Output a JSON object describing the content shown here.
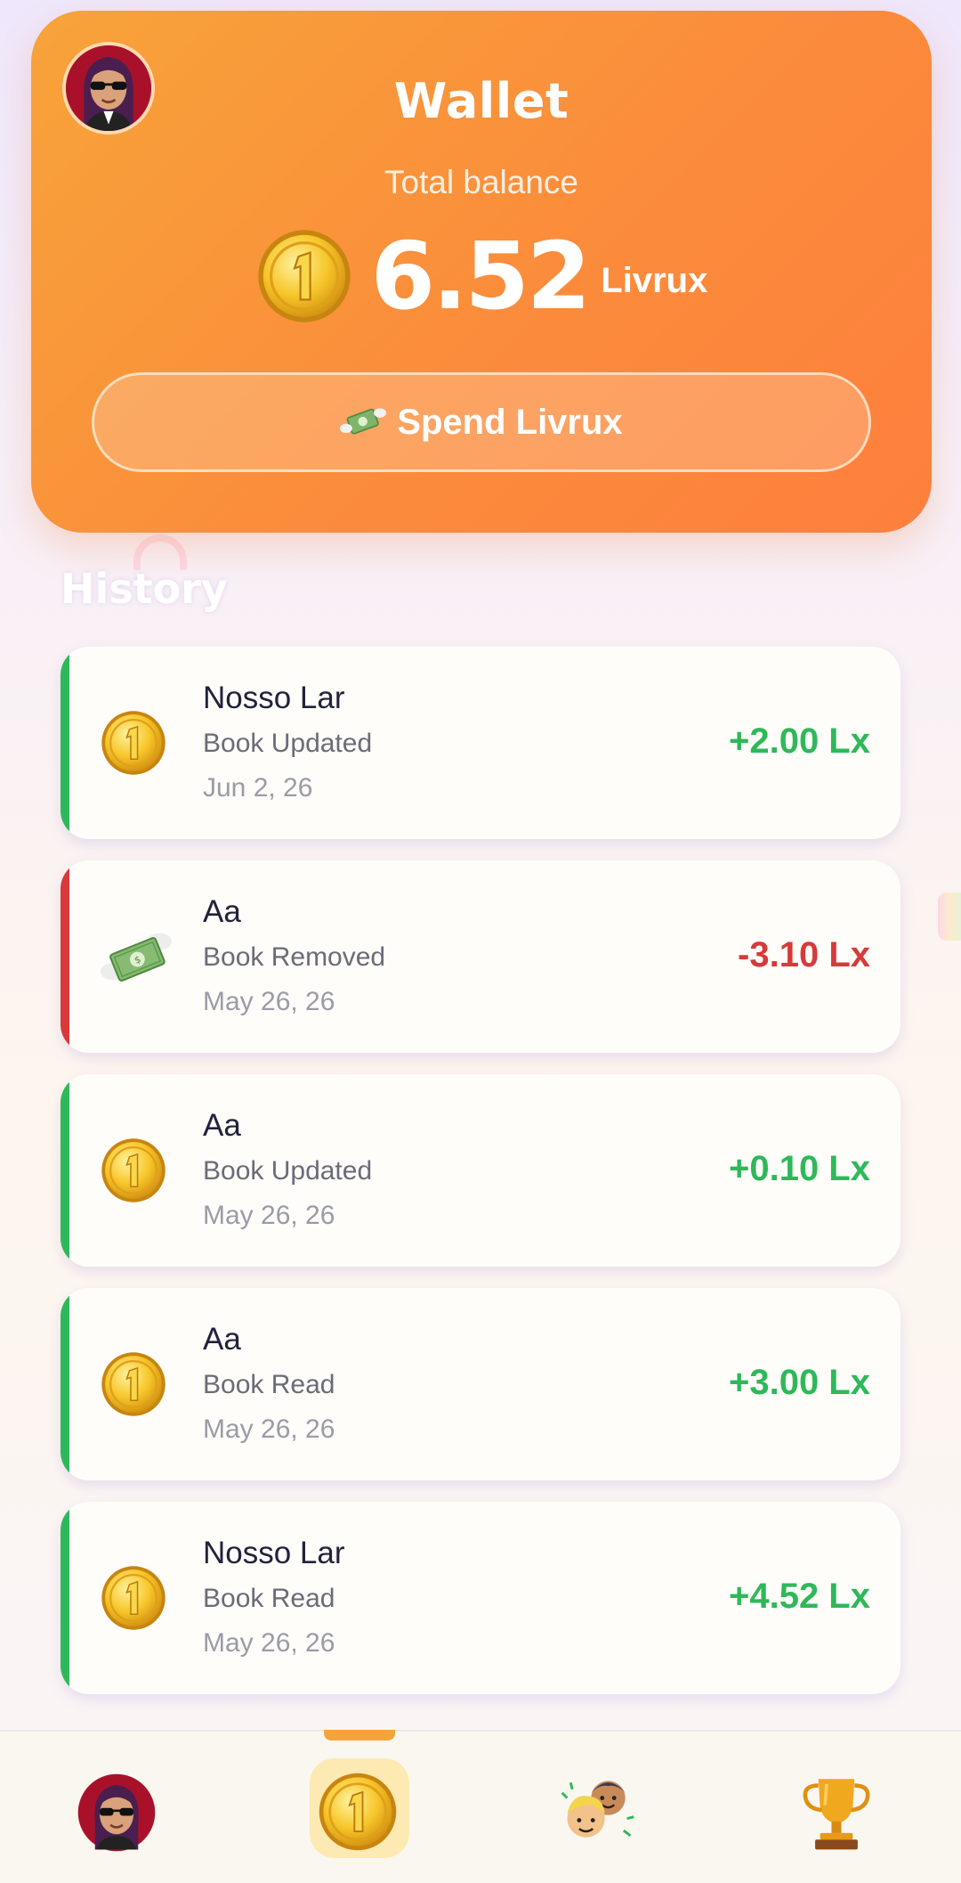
{
  "wallet": {
    "title": "Wallet",
    "balance_label": "Total balance",
    "balance_amount": "6.52",
    "balance_unit": "Livrux",
    "spend_label": "Spend Livrux"
  },
  "history": {
    "title": "History",
    "items": [
      {
        "title": "Nosso Lar",
        "type": "Book Updated",
        "date": "Jun 2, 26",
        "amount": "+2.00 Lx",
        "kind": "credit"
      },
      {
        "title": "Aa",
        "type": "Book Removed",
        "date": "May 26, 26",
        "amount": "-3.10 Lx",
        "kind": "debit"
      },
      {
        "title": "Aa",
        "type": "Book Updated",
        "date": "May 26, 26",
        "amount": "+0.10 Lx",
        "kind": "credit"
      },
      {
        "title": "Aa",
        "type": "Book Read",
        "date": "May 26, 26",
        "amount": "+3.00 Lx",
        "kind": "credit"
      },
      {
        "title": "Nosso Lar",
        "type": "Book Read",
        "date": "May 26, 26",
        "amount": "+4.52 Lx",
        "kind": "credit"
      }
    ]
  },
  "colors": {
    "credit": "#2fb85a",
    "debit": "#d63a3a",
    "accent": "#f7a33a"
  },
  "icons": {
    "credit": "coin-icon",
    "debit": "money-wings-icon"
  },
  "bottom_nav": {
    "items": [
      "profile-avatar-icon",
      "coin-icon",
      "friends-icon",
      "trophy-icon"
    ],
    "active_index": 1
  }
}
